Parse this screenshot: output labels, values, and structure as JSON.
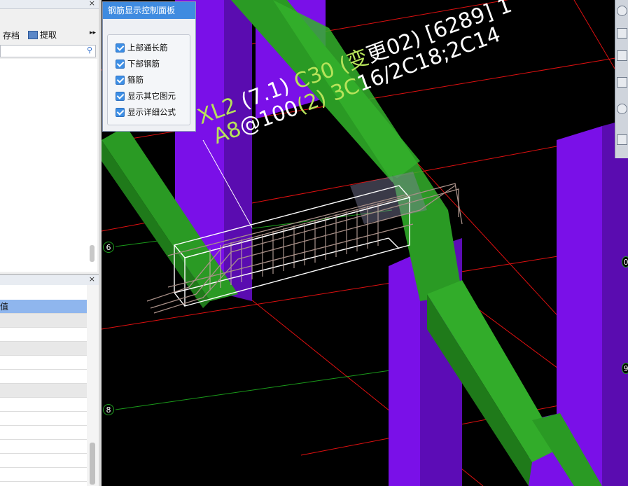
{
  "left_panel": {
    "close_glyph": "×",
    "toolbar": {
      "save_label": "存档",
      "extract_label": "提取",
      "more_glyph": "▸▸"
    },
    "search": {
      "placeholder": "",
      "value": "",
      "icon": "search-icon"
    },
    "property_panel": {
      "close_glyph": "×",
      "header_value_col": "值"
    }
  },
  "control_panel": {
    "title": "钢筋显示控制面板",
    "options": [
      {
        "label": "上部通长筋",
        "checked": true
      },
      {
        "label": "下部钢筋",
        "checked": true
      },
      {
        "label": "箍筋",
        "checked": true
      },
      {
        "label": "显示其它图元",
        "checked": true
      },
      {
        "label": "显示详细公式",
        "checked": true
      }
    ]
  },
  "annotation": {
    "line1": {
      "a": "XL2",
      "b": " (7.1) ",
      "c": "C30 (变",
      "d": "更02) [6289] 1"
    },
    "line2": {
      "a": "A8",
      "b": "@100",
      "c": "(2) 3C",
      "d": "16/2C18;2C14"
    }
  },
  "axis_markers": [
    {
      "label": "6"
    },
    {
      "label": "8"
    },
    {
      "label": "9"
    },
    {
      "label": "0"
    }
  ],
  "colors": {
    "background": "#000000",
    "beam_purple": "#7a10e8",
    "beam_green": "#2a9a24",
    "label_green": "#b7e35a",
    "grid_red": "#e01010",
    "panel_blue": "#3f8be0"
  }
}
